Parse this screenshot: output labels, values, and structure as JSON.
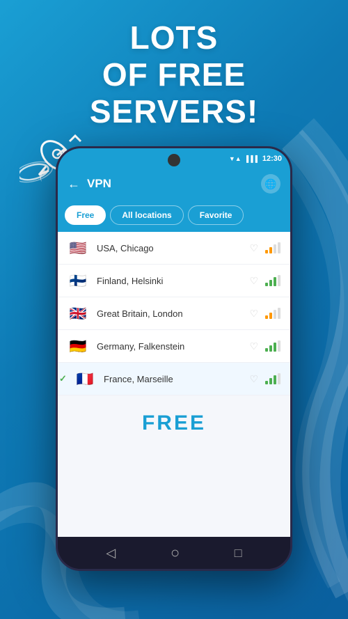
{
  "background": {
    "gradient_start": "#1a9fd4",
    "gradient_end": "#0a5f9e"
  },
  "headline": {
    "line1": "Lots",
    "line2": "of free",
    "line3": "servers!"
  },
  "status_bar": {
    "time": "12:30",
    "signal_icon": "▼▲",
    "wifi_icon": "WiFi",
    "battery_icon": "🔋"
  },
  "vpn_header": {
    "back_label": "←",
    "title": "VPN",
    "globe_label": "🌐"
  },
  "tabs": [
    {
      "id": "free",
      "label": "Free",
      "active": true
    },
    {
      "id": "all",
      "label": "All locations",
      "active": false
    },
    {
      "id": "favorite",
      "label": "Favorite",
      "active": false
    }
  ],
  "servers": [
    {
      "id": "usa",
      "name": "USA, Chicago",
      "flag_emoji": "🇺🇸",
      "signal_level": 2,
      "signal_color": "orange",
      "favorite": false,
      "selected": false
    },
    {
      "id": "finland",
      "name": "Finland, Helsinki",
      "flag_emoji": "🇫🇮",
      "signal_level": 3,
      "signal_color": "green",
      "favorite": false,
      "selected": false
    },
    {
      "id": "gb",
      "name": "Great Britain, London",
      "flag_emoji": "🇬🇧",
      "signal_level": 2,
      "signal_color": "orange",
      "favorite": false,
      "selected": false
    },
    {
      "id": "germany",
      "name": "Germany, Falkenstein",
      "flag_emoji": "🇩🇪",
      "signal_level": 3,
      "signal_color": "green",
      "favorite": false,
      "selected": false
    },
    {
      "id": "france",
      "name": "France, Marseille",
      "flag_emoji": "🇫🇷",
      "signal_level": 3,
      "signal_color": "green",
      "favorite": false,
      "selected": true
    }
  ],
  "free_label": "FREE",
  "bottom_nav": {
    "back": "◁",
    "home": "○",
    "recent": "□"
  }
}
